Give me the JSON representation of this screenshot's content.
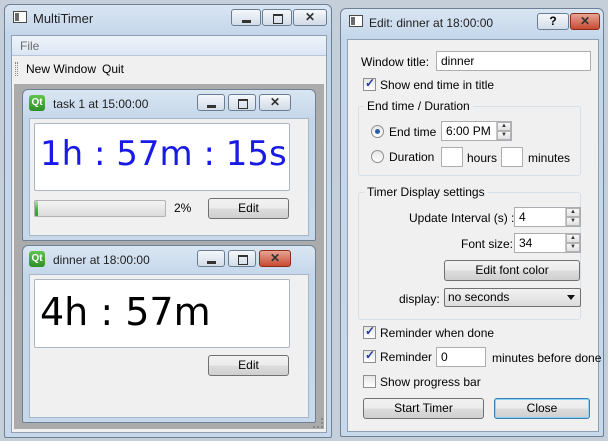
{
  "main_window": {
    "title": "MultiTimer",
    "menu_file": "File",
    "toolbar_new_window": "New Window",
    "toolbar_quit": "Quit"
  },
  "timers": [
    {
      "title": "task 1 at 15:00:00",
      "display_text": "1h : 57m : 15s",
      "display_color": "#1a1ae6",
      "progress": 2,
      "progress_text": "2%",
      "edit_label": "Edit"
    },
    {
      "title": "dinner at 18:00:00",
      "display_text": "4h : 57m",
      "display_color": "#000000",
      "edit_label": "Edit"
    }
  ],
  "edit_dialog": {
    "title": "Edit: dinner at 18:00:00",
    "help_button": "?",
    "window_title_label": "Window title:",
    "window_title_value": "dinner",
    "show_end_time_label": "Show end time in title",
    "show_end_time_checked": true,
    "end_time_group_title": "End time / Duration",
    "end_time_label": "End time",
    "end_time_value": "6:00 PM",
    "end_time_selected": true,
    "duration_label": "Duration",
    "hours_label": "hours",
    "minutes_label": "minutes",
    "display_group_title": "Timer Display settings",
    "update_interval_label": "Update Interval (s) :",
    "update_interval_value": "4",
    "font_size_label": "Font size:",
    "font_size_value": "34",
    "edit_font_color_button": "Edit font color",
    "display_label": "display:",
    "display_value": "no seconds",
    "reminder_when_done_label": "Reminder when done",
    "reminder_when_done_checked": true,
    "reminder_label": "Reminder",
    "reminder_checked": true,
    "reminder_minutes_value": "0",
    "minutes_before_done_label": "minutes before done",
    "show_progress_label": "Show progress bar",
    "show_progress_checked": false,
    "start_timer_button": "Start Timer",
    "close_button": "Close"
  },
  "colors": {
    "timer1_font": "#1a1ae6",
    "progress_fill": "#37b82d",
    "close_button_hover": "#c84a32"
  }
}
